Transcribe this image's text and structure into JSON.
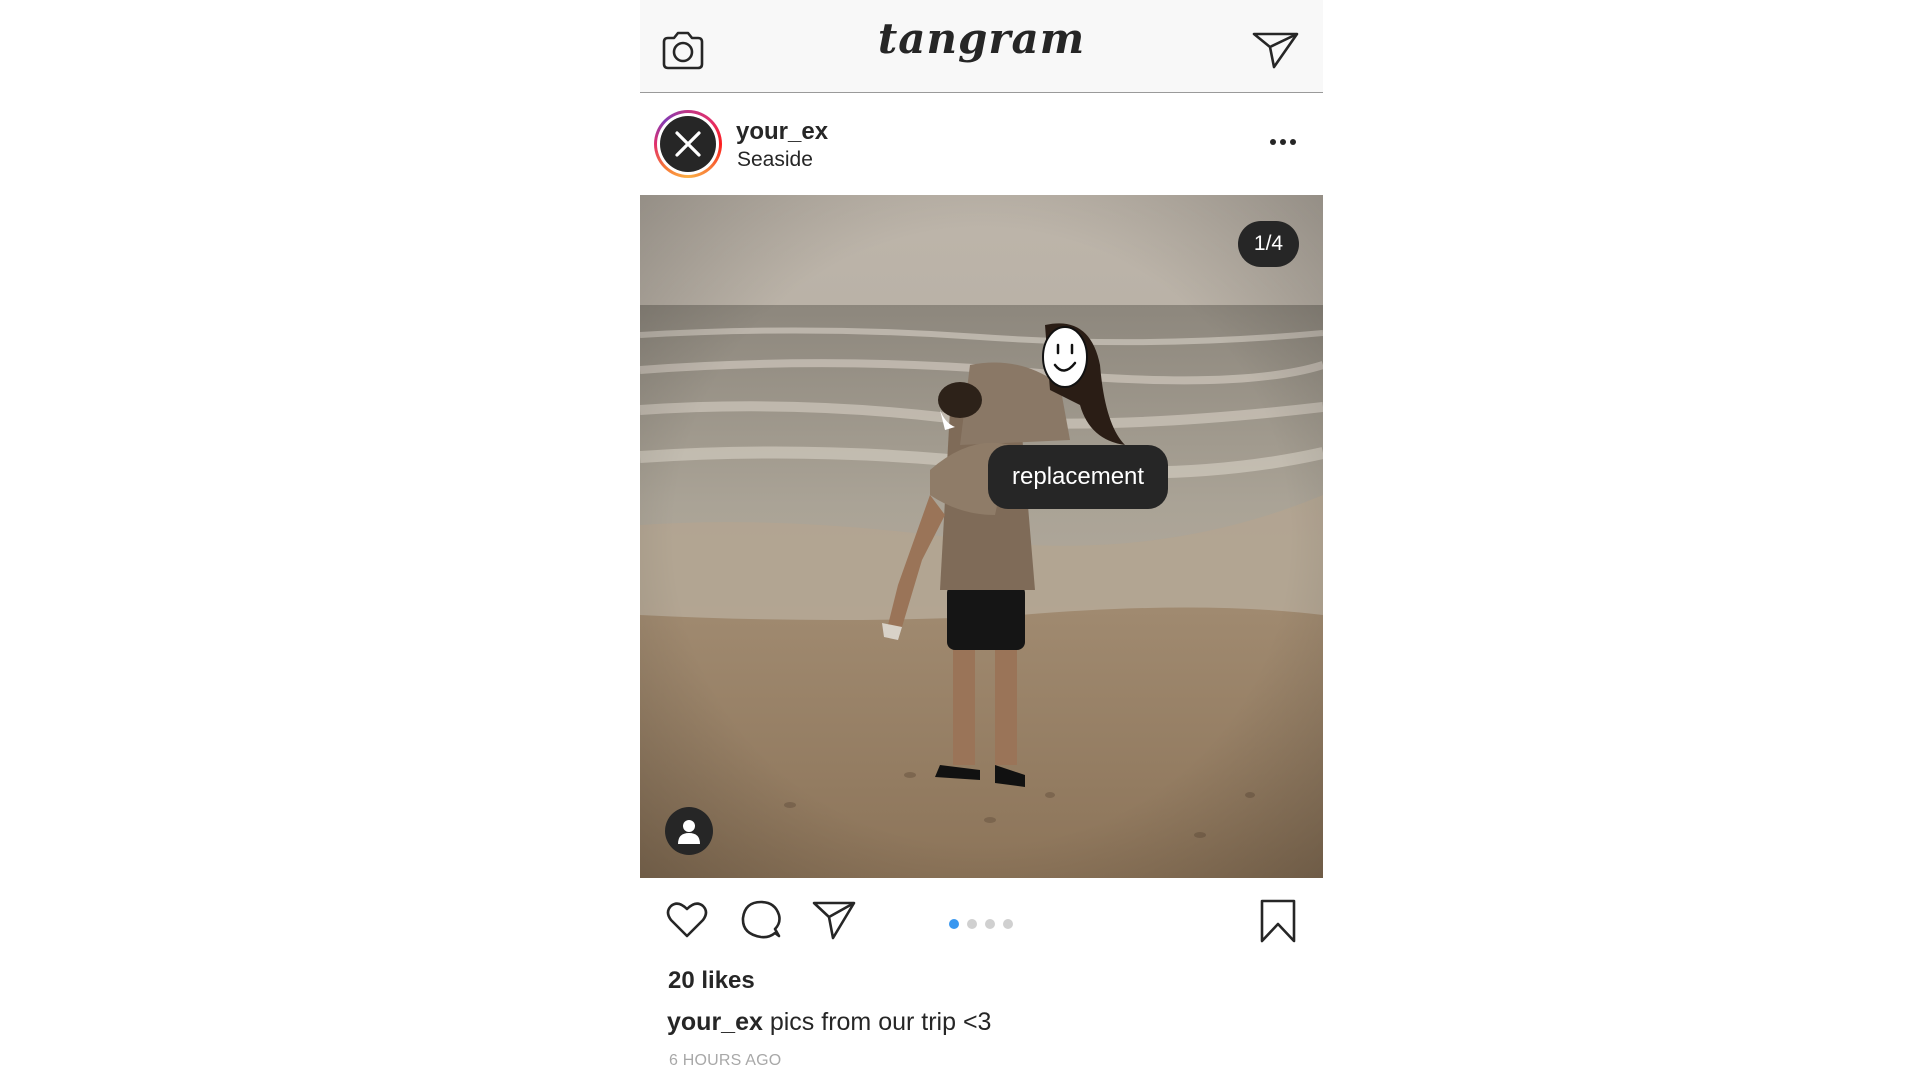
{
  "app": {
    "logo_text": "tangram",
    "icons": {
      "camera": "camera-icon",
      "direct": "paper-plane-icon"
    }
  },
  "post": {
    "username": "your_ex",
    "location": "Seaside",
    "avatar_icon": "x-icon",
    "more_icon": "ellipsis-icon",
    "photo_counter": "1/4",
    "tag_label": "replacement",
    "tag_button_icon": "person-icon",
    "carousel": {
      "total": 4,
      "active_index": 0,
      "active_color": "#3897f0",
      "inactive_color": "#d0d0d0"
    },
    "actions": {
      "like_icon": "heart-icon",
      "comment_icon": "comment-icon",
      "share_icon": "paper-plane-icon",
      "save_icon": "bookmark-icon"
    },
    "likes_text": "20 likes",
    "caption_user": "your_ex",
    "caption_text": "pics from our trip <3",
    "time_text": "6 HOURS AGO"
  },
  "colors": {
    "text": "#262626",
    "muted": "#a8a8a8",
    "topbar_bg": "#f8f8f8"
  }
}
